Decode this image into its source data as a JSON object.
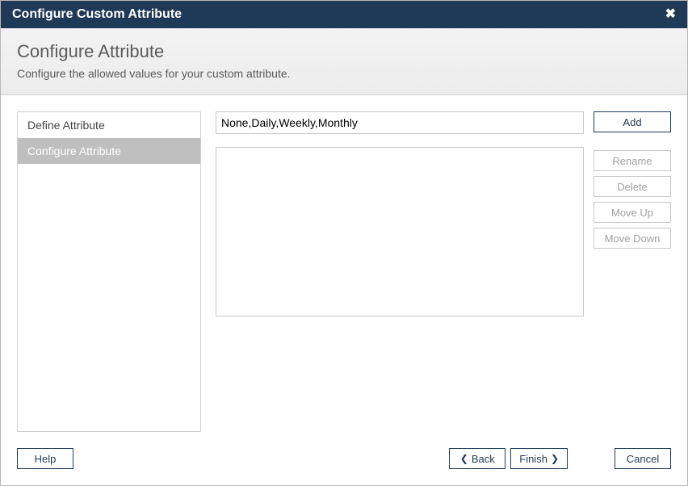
{
  "titlebar": {
    "title": "Configure Custom Attribute"
  },
  "header": {
    "title": "Configure Attribute",
    "description": "Configure the allowed values for your custom attribute."
  },
  "sidebar": {
    "items": [
      {
        "label": "Define Attribute",
        "active": false
      },
      {
        "label": "Configure Attribute",
        "active": true
      }
    ]
  },
  "main": {
    "value_input": "None,Daily,Weekly,Monthly",
    "listbox_items": []
  },
  "buttons": {
    "add": "Add",
    "rename": "Rename",
    "delete": "Delete",
    "move_up": "Move Up",
    "move_down": "Move Down"
  },
  "footer": {
    "help": "Help",
    "back": "Back",
    "finish": "Finish",
    "cancel": "Cancel"
  }
}
